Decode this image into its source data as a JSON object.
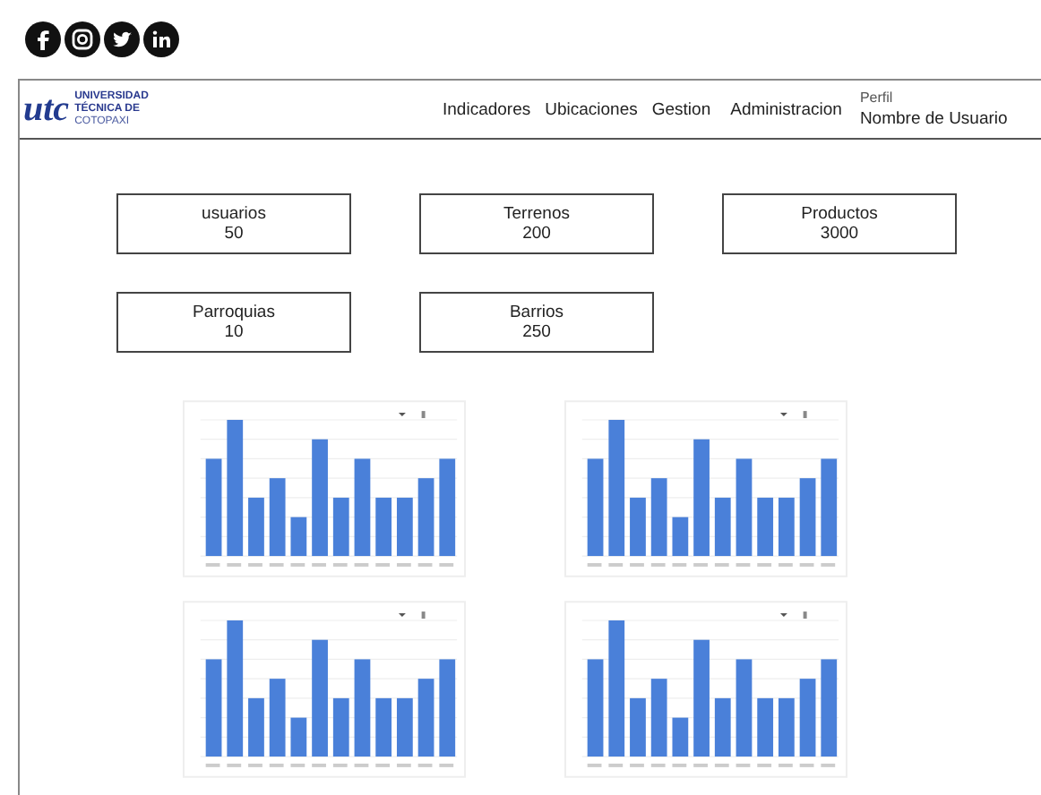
{
  "social_icons": [
    {
      "kind": "facebook"
    },
    {
      "kind": "instagram"
    },
    {
      "kind": "twitter"
    },
    {
      "kind": "linkedin"
    }
  ],
  "header": {
    "logo_mark": "utc",
    "logo_lines": [
      "UNIVERSIDAD",
      "TÉCNICA DE",
      "COTOPAXI"
    ],
    "nav": [
      "Indicadores",
      "Ubicaciones",
      "Gestion",
      "Administracion"
    ],
    "profile": {
      "label": "Perfil",
      "user": "Nombre de Usuario"
    }
  },
  "stats": [
    {
      "label": "usuarios",
      "value": "50"
    },
    {
      "label": "Terrenos",
      "value": "200"
    },
    {
      "label": "Productos",
      "value": "3000"
    },
    {
      "label": "Parroquias",
      "value": "10"
    },
    {
      "label": "Barrios",
      "value": "250"
    }
  ]
}
